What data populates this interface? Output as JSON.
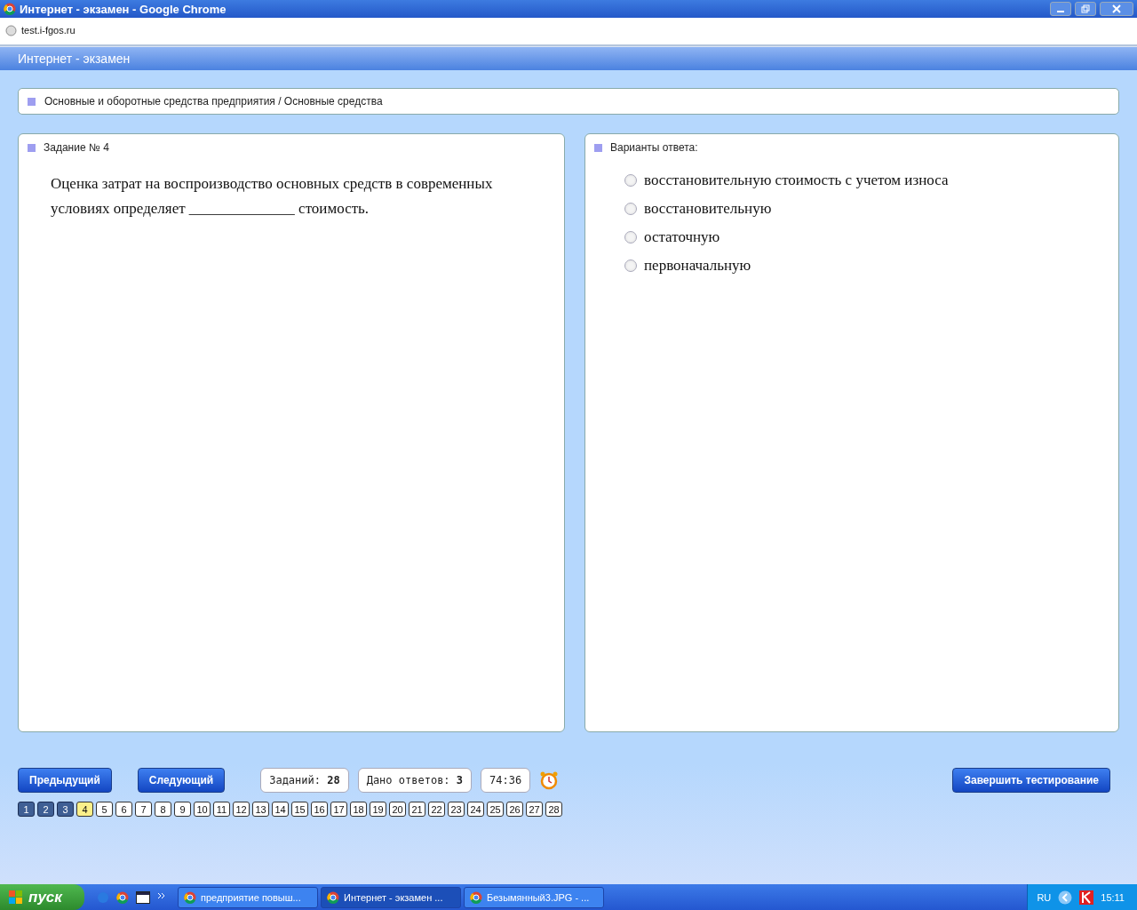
{
  "window": {
    "title": "Интернет - экзамен - Google Chrome"
  },
  "address": "test.i-fgos.ru",
  "app_header": "Интернет - экзамен",
  "breadcrumb": "Основные и оборотные средства предприятия / Основные средства",
  "task": {
    "heading": "Задание № 4",
    "text": "Оценка затрат на воспроизводство основных средств в современных условиях определяет ______________ стоимость."
  },
  "answers": {
    "heading": "Варианты ответа:",
    "options": [
      {
        "label": "восстановительную стоимость с учетом износа",
        "selected": false
      },
      {
        "label": "восстановительную",
        "selected": false
      },
      {
        "label": "остаточную",
        "selected": false
      },
      {
        "label": "первоначальную",
        "selected": false
      }
    ]
  },
  "nav": {
    "prev": "Предыдущий",
    "next": "Следующий",
    "finish": "Завершить тестирование"
  },
  "stats": [
    {
      "label": "Заданий:",
      "value": "28"
    },
    {
      "label": "Дано ответов:",
      "value": "3"
    },
    {
      "label": "74:36"
    }
  ],
  "pages": [
    {
      "label": "1",
      "answered": true,
      "selected": false
    },
    {
      "label": "2",
      "answered": true,
      "selected": false
    },
    {
      "label": "3",
      "answered": true,
      "selected": false
    },
    {
      "label": "4",
      "answered": false,
      "selected": true
    },
    {
      "label": "5",
      "answered": false,
      "selected": false
    },
    {
      "label": "6",
      "answered": false,
      "selected": false
    },
    {
      "label": "7",
      "answered": false,
      "selected": false
    },
    {
      "label": "8",
      "answered": false,
      "selected": false
    },
    {
      "label": "9",
      "answered": false,
      "selected": false
    },
    {
      "label": "10",
      "answered": false,
      "selected": false
    },
    {
      "label": "11",
      "answered": false,
      "selected": false
    },
    {
      "label": "12",
      "answered": false,
      "selected": false
    },
    {
      "label": "13",
      "answered": false,
      "selected": false
    },
    {
      "label": "14",
      "answered": false,
      "selected": false
    },
    {
      "label": "15",
      "answered": false,
      "selected": false
    },
    {
      "label": "16",
      "answered": false,
      "selected": false
    },
    {
      "label": "17",
      "answered": false,
      "selected": false
    },
    {
      "label": "18",
      "answered": false,
      "selected": false
    },
    {
      "label": "19",
      "answered": false,
      "selected": false
    },
    {
      "label": "20",
      "answered": false,
      "selected": false
    },
    {
      "label": "21",
      "answered": false,
      "selected": false
    },
    {
      "label": "22",
      "answered": false,
      "selected": false
    },
    {
      "label": "23",
      "answered": false,
      "selected": false
    },
    {
      "label": "24",
      "answered": false,
      "selected": false
    },
    {
      "label": "25",
      "answered": false,
      "selected": false
    },
    {
      "label": "26",
      "answered": false,
      "selected": false
    },
    {
      "label": "27",
      "answered": false,
      "selected": false
    },
    {
      "label": "28",
      "answered": false,
      "selected": false
    }
  ],
  "taskbar": {
    "start": "пуск",
    "windows": [
      {
        "label": "предприятие повыш...",
        "selected": false
      },
      {
        "label": "Интернет - экзамен ...",
        "selected": true
      },
      {
        "label": "Безымянный3.JPG - ...",
        "selected": false
      }
    ],
    "lang": "RU",
    "clock": "15:11"
  }
}
